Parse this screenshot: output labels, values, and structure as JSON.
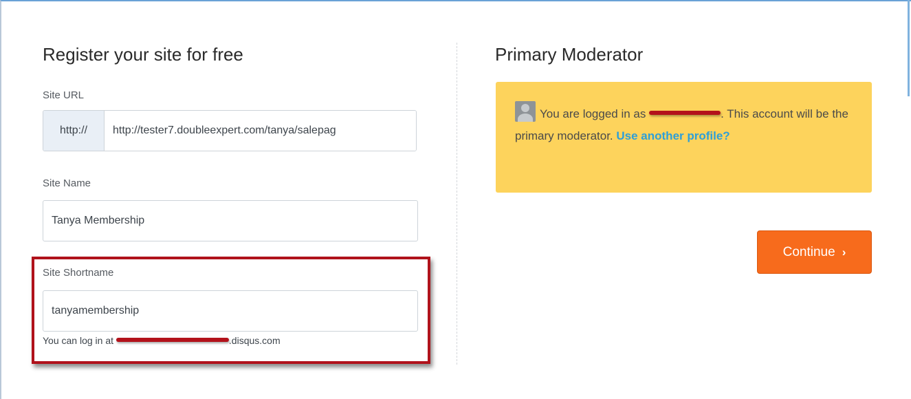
{
  "register": {
    "heading": "Register your site for free",
    "site_url": {
      "label": "Site URL",
      "prefix": "http://",
      "value": "http://tester7.doubleexpert.com/tanya/salepag"
    },
    "site_name": {
      "label": "Site Name",
      "value": "Tanya Membership"
    },
    "site_shortname": {
      "label": "Site Shortname",
      "value": "tanyamembership",
      "help_prefix": "You can log in at ",
      "help_suffix": ".disqus.com"
    }
  },
  "moderator": {
    "heading": "Primary Moderator",
    "notice_prefix": "You are logged in as ",
    "notice_suffix": ". This account will be the primary moderator. ",
    "link_text": "Use another profile?"
  },
  "actions": {
    "continue_label": "Continue",
    "continue_icon": "chevron-right-icon"
  },
  "colors": {
    "notice_bg": "#fdd35c",
    "continue_bg": "#f76b1c",
    "link": "#2e9fd8",
    "highlight": "#b0121b"
  }
}
